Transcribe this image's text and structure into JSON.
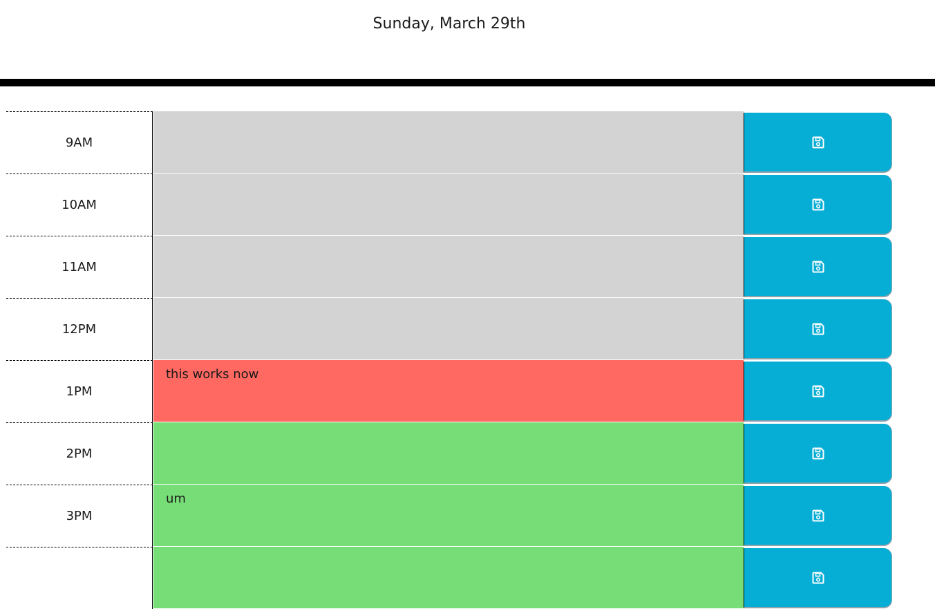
{
  "header": {
    "current_day": "Sunday, March 29th"
  },
  "colors": {
    "past": "#d3d3d3",
    "present": "#ff6961",
    "future": "#77dd77",
    "save_button": "#06aed5",
    "divider": "#000000"
  },
  "save_icon": "floppy-disk-icon",
  "timeblocks": [
    {
      "hour": "9AM",
      "text": "",
      "state": "past"
    },
    {
      "hour": "10AM",
      "text": "",
      "state": "past"
    },
    {
      "hour": "11AM",
      "text": "",
      "state": "past"
    },
    {
      "hour": "12PM",
      "text": "",
      "state": "past"
    },
    {
      "hour": "1PM",
      "text": "this works now",
      "state": "present"
    },
    {
      "hour": "2PM",
      "text": "",
      "state": "future"
    },
    {
      "hour": "3PM",
      "text": "um",
      "state": "future"
    },
    {
      "hour": "",
      "text": "",
      "state": "future"
    }
  ]
}
